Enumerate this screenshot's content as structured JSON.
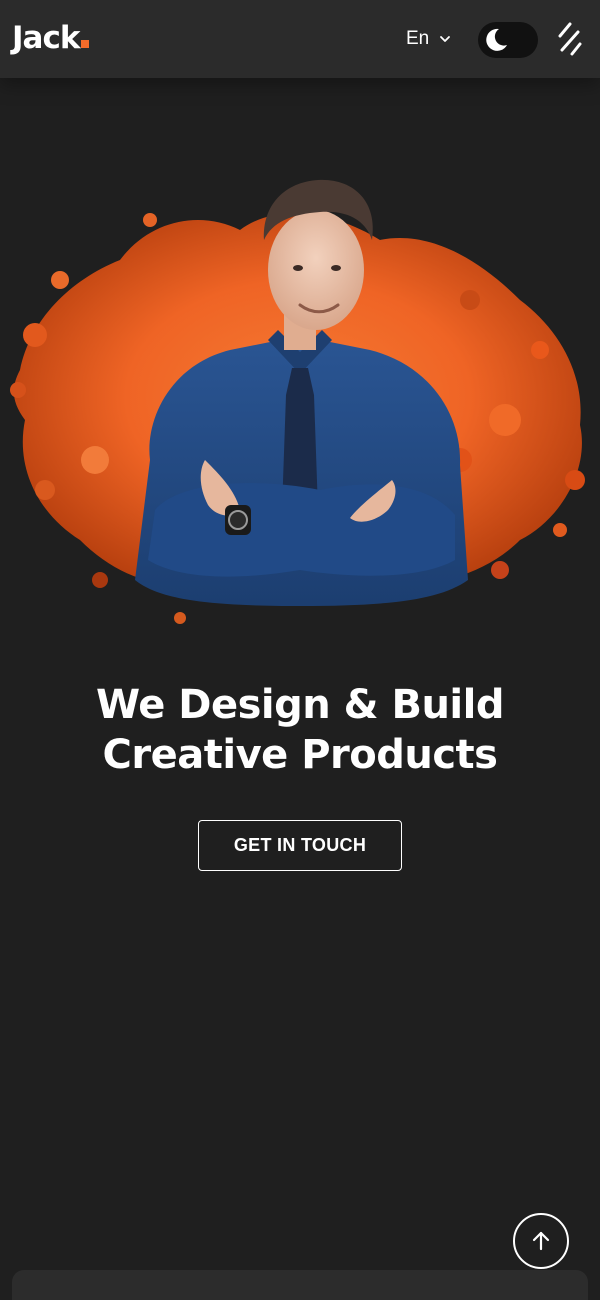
{
  "header": {
    "logo_text": "Jack",
    "language": "En",
    "icons": {
      "dropdown": "chevron-down-icon",
      "theme": "moon-icon",
      "menu": "menu-icon"
    }
  },
  "hero": {
    "headline_line1": "We Design & Build",
    "headline_line2": "Creative Products",
    "cta_label": "GET IN TOUCH"
  },
  "scroll_top": {
    "icon": "arrow-up-icon"
  },
  "colors": {
    "background": "#1f1f1f",
    "header": "#2b2b2b",
    "accent": "#f46b2a",
    "text": "#ffffff",
    "shirt": "#23487f"
  }
}
